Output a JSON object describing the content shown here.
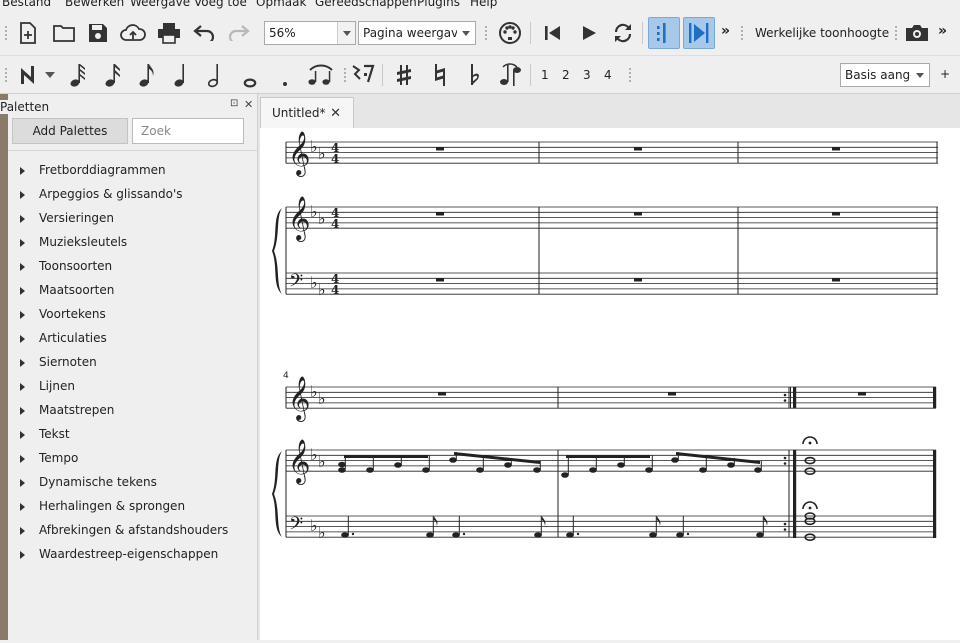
{
  "menu": [
    "Bestand",
    "Bewerken",
    "Weergave",
    "Voeg toe",
    "Opmaak",
    "Gereedschappen",
    "Plugins",
    "Help"
  ],
  "toolbar": {
    "zoom_value": "56%",
    "view_mode": "Pagina weergave",
    "concert_pitch_label": "Werkelijke toonhoogte",
    "overflow_1": "»",
    "overflow_2": "»"
  },
  "note_input": {
    "voices": [
      "1",
      "2",
      "3",
      "4"
    ],
    "workspace": "Basis aangep",
    "add_workspace": "+"
  },
  "palettes": {
    "title": "Paletten",
    "add_button": "Add Palettes",
    "search_placeholder": "Zoek",
    "items": [
      "Fretborddiagrammen",
      "Arpeggios & glissando's",
      "Versieringen",
      "Muzieksleutels",
      "Toonsoorten",
      "Maatsoorten",
      "Voortekens",
      "Articulaties",
      "Siernoten",
      "Lijnen",
      "Maatstrepen",
      "Tekst",
      "Tempo",
      "Dynamische tekens",
      "Herhalingen & sprongen",
      "Afbrekingen & afstandshouders",
      "Waardestreep-eigenschappen"
    ]
  },
  "document": {
    "tab_title": "Untitled*",
    "tab_close": "✕",
    "time_signature": [
      "4",
      "4"
    ],
    "measure_number": "4"
  },
  "icons": {
    "new": "new-file-icon",
    "open": "open-folder-icon",
    "save": "save-icon",
    "cloud": "cloud-upload-icon",
    "print": "print-icon",
    "undo": "undo-icon",
    "redo": "redo-icon",
    "midi": "midi-input-icon",
    "rewind": "rewind-icon",
    "play": "play-icon",
    "loop": "loop-icon",
    "metronome": "metronome-icon",
    "countin": "count-in-icon",
    "camera": "camera-icon"
  }
}
